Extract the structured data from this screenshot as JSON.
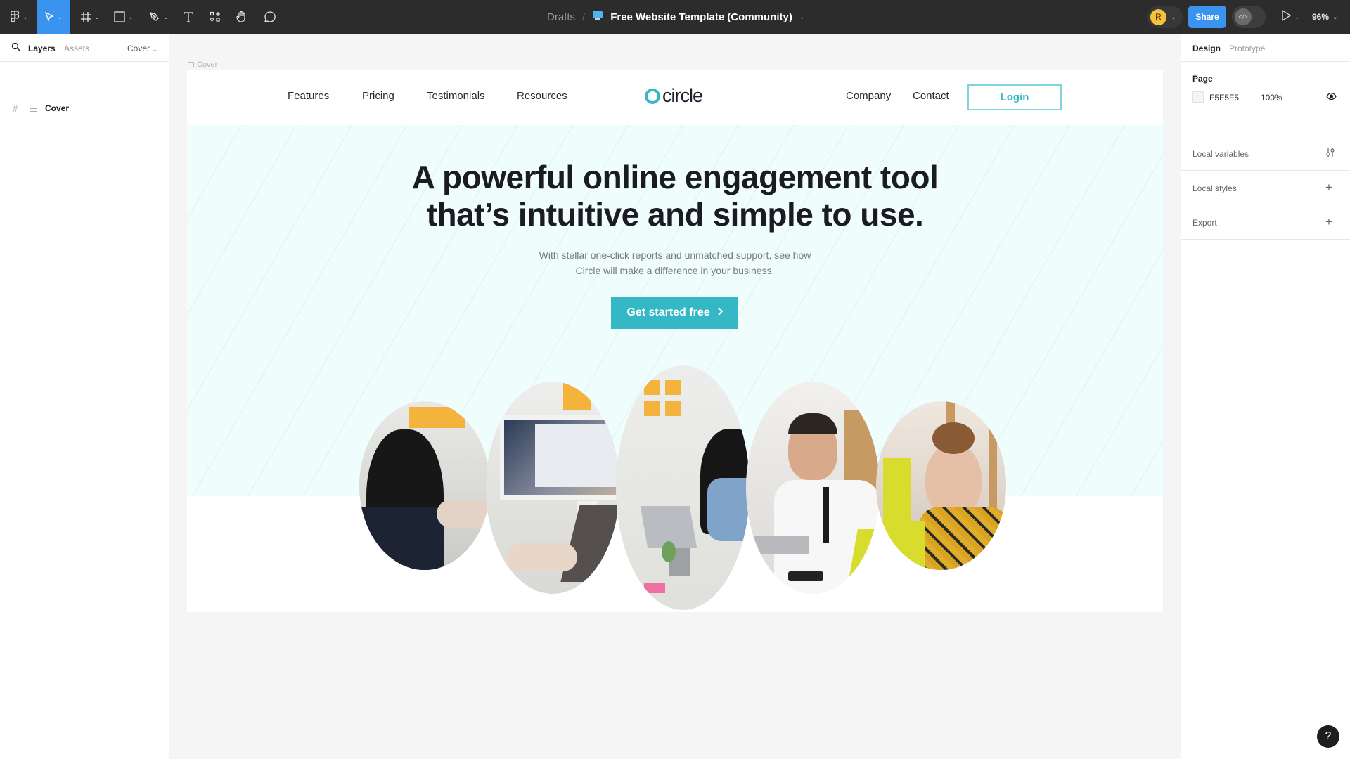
{
  "toolbar": {
    "tools": [
      {
        "name": "main-menu",
        "icon": "figma-logo-icon"
      },
      {
        "name": "move",
        "icon": "move-cursor-icon",
        "active": true
      },
      {
        "name": "frame",
        "icon": "frame-hash-icon"
      },
      {
        "name": "shape",
        "icon": "rectangle-icon"
      },
      {
        "name": "pen",
        "icon": "pen-icon"
      },
      {
        "name": "text",
        "icon": "text-icon"
      },
      {
        "name": "resources",
        "icon": "components-icon"
      },
      {
        "name": "hand",
        "icon": "hand-icon"
      },
      {
        "name": "comment",
        "icon": "comment-icon"
      }
    ],
    "breadcrumb": {
      "folder": "Drafts",
      "separator": "/",
      "file_icon": "monitor-emoji-icon",
      "file_title": "Free Website Template (Community)"
    },
    "avatar_initial": "R",
    "share_label": "Share",
    "dev_mode_icon": "code-brackets-icon",
    "present_icon": "play-icon",
    "zoom_level": "96%"
  },
  "left_panel": {
    "tabs": [
      "Layers",
      "Assets"
    ],
    "active_tab": "Layers",
    "page_selector": "Cover",
    "layers": [
      {
        "name": "Cover",
        "type": "frame"
      }
    ]
  },
  "canvas": {
    "frame_label": "Cover",
    "site": {
      "nav_left": [
        "Features",
        "Pricing",
        "Testimonials",
        "Resources"
      ],
      "logo_text": "circle",
      "nav_right": [
        "Company",
        "Contact"
      ],
      "login_label": "Login",
      "headline_line1": "A powerful online engagement tool",
      "headline_line2": "that’s intuitive and simple to use.",
      "subtext_line1": "With stellar one-click reports and unmatched support, see how",
      "subtext_line2": "Circle will make a difference in your business.",
      "cta_label": "Get started free",
      "cta_icon": "chevron-right-icon",
      "photos": [
        "meeting-photo-1",
        "meeting-photo-2",
        "meeting-photo-3",
        "meeting-photo-4",
        "meeting-photo-5"
      ],
      "colors": {
        "accent": "#35B8C5",
        "hero_bg": "#EFFDFD",
        "heading": "#1B1B22"
      }
    }
  },
  "right_panel": {
    "tabs": [
      "Design",
      "Prototype"
    ],
    "active_tab": "Design",
    "page": {
      "title": "Page",
      "color_hex": "F5F5F5",
      "opacity": "100%"
    },
    "sections": [
      {
        "label": "Local variables",
        "action_icon": "sliders-icon"
      },
      {
        "label": "Local styles",
        "action_icon": "plus-icon"
      },
      {
        "label": "Export",
        "action_icon": "plus-icon"
      }
    ]
  },
  "help_label": "?"
}
